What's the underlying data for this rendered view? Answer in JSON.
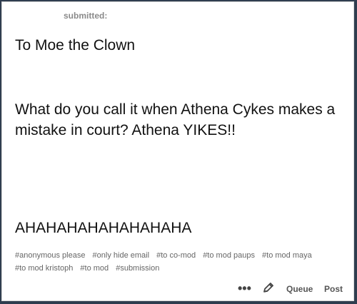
{
  "post": {
    "submitted_label": "submitted:",
    "lines": [
      "To Moe the Clown",
      "What do you call it when Athena Cykes makes a mistake in court? Athena YIKES!!",
      "AHAHAHAHAHAHAHAHA"
    ],
    "tags": [
      "#anonymous please",
      "#only hide email",
      "#to co-mod",
      "#to mod paups",
      "#to mod maya",
      "#to mod kristoph",
      "#to mod",
      "#submission"
    ]
  },
  "actions": {
    "more_icon": "more-dots-icon",
    "edit_icon": "pencil-icon",
    "queue_label": "Queue",
    "post_label": "Post"
  },
  "colors": {
    "background": "#2f3d4f",
    "card": "#ffffff",
    "text": "#111111",
    "muted": "#8a8a8a"
  }
}
